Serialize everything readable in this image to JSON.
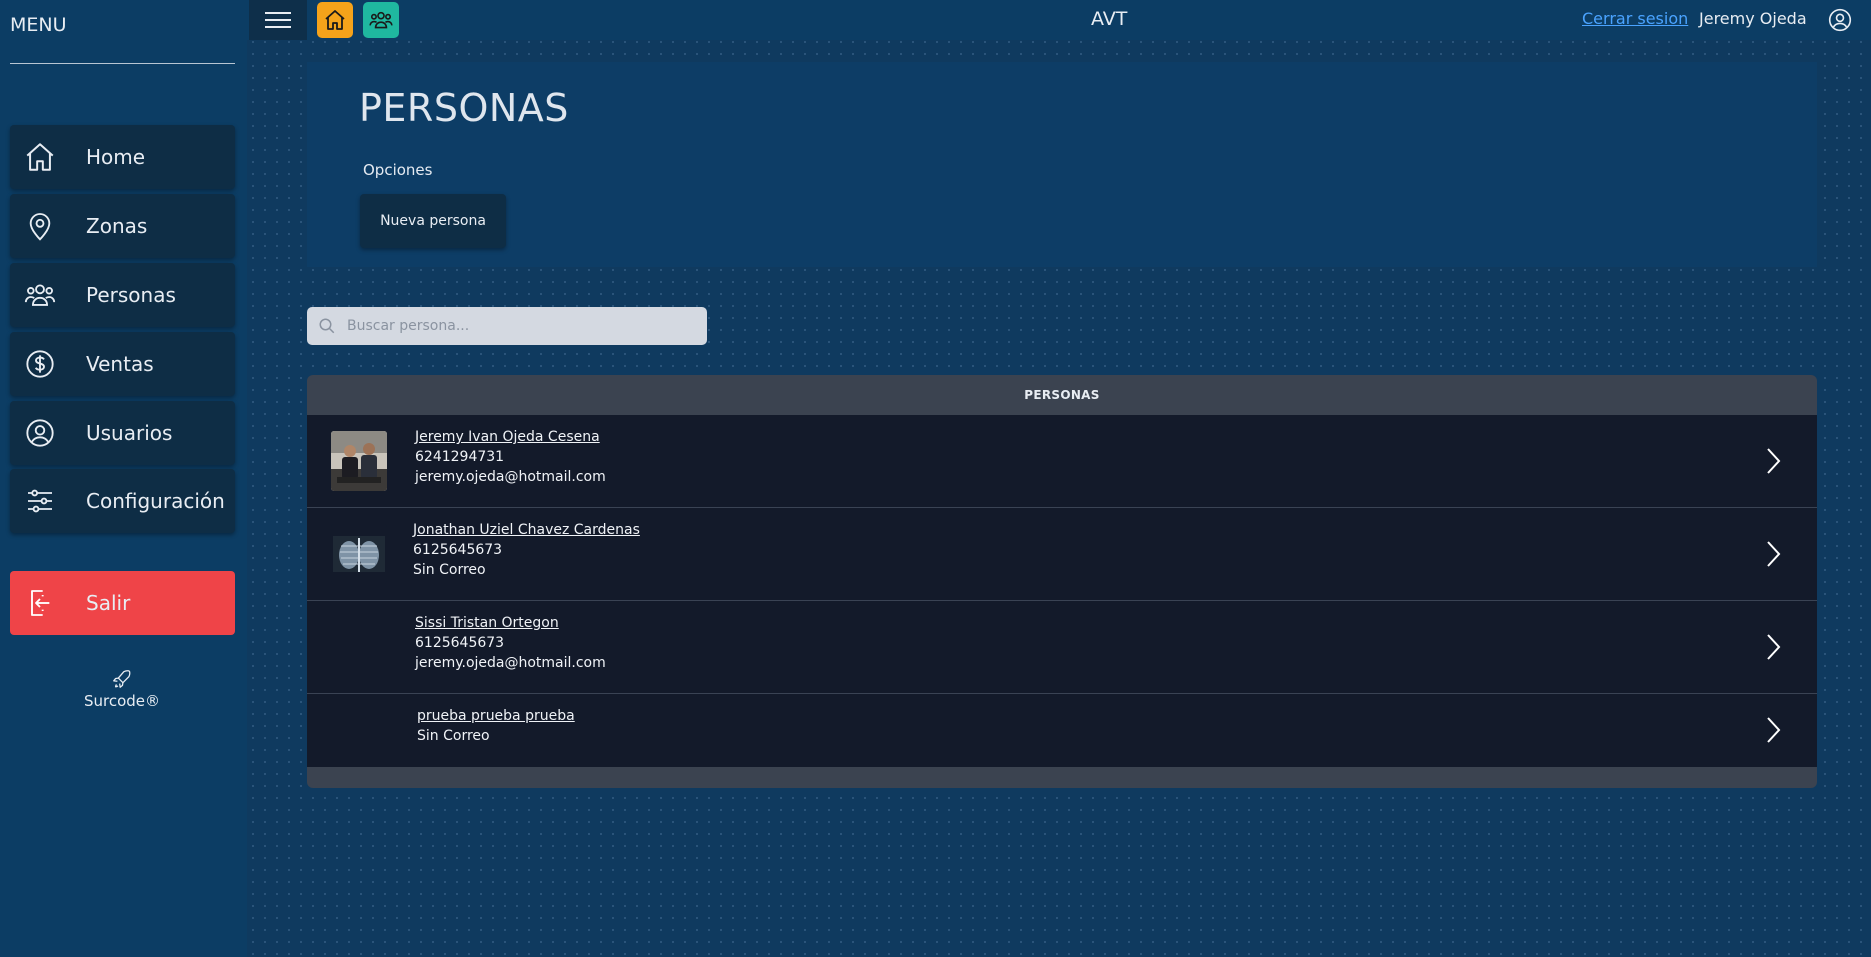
{
  "sidebar": {
    "menu_title": "MENU",
    "items": [
      {
        "label": "Home",
        "icon": "home-icon"
      },
      {
        "label": "Zonas",
        "icon": "map-pin-icon"
      },
      {
        "label": "Personas",
        "icon": "users-icon"
      },
      {
        "label": "Ventas",
        "icon": "dollar-icon"
      },
      {
        "label": "Usuarios",
        "icon": "user-circle-icon"
      },
      {
        "label": "Configuración",
        "icon": "sliders-icon"
      }
    ],
    "exit_label": "Salir",
    "brand": "Surcode®"
  },
  "topbar": {
    "app_title": "AVT",
    "logout_label": "Cerrar sesion",
    "user_name": "Jeremy Ojeda",
    "home_button_color": "#f5a31a",
    "people_button_color": "#1fb8a0"
  },
  "panel": {
    "title": "PERSONAS",
    "options_label": "Opciones",
    "new_button": "Nueva persona"
  },
  "search": {
    "placeholder": "Buscar persona..."
  },
  "table": {
    "header": "PERSONAS",
    "rows": [
      {
        "name": "Jeremy Ivan Ojeda Cesena",
        "phone": "6241294731",
        "email": "jeremy.ojeda@hotmail.com",
        "avatar": "photo"
      },
      {
        "name": "Jonathan Uziel Chavez Cardenas",
        "phone": "6125645673",
        "email": "Sin Correo",
        "avatar": "xray"
      },
      {
        "name": "Sissi Tristan Ortegon",
        "phone": "6125645673",
        "email": "jeremy.ojeda@hotmail.com",
        "avatar": "none"
      },
      {
        "name": "prueba prueba prueba",
        "phone": "",
        "email": "Sin Correo",
        "avatar": "none"
      }
    ]
  },
  "colors": {
    "sidebar_bg": "#0c3d64",
    "nav_item_bg": "#0e2d45",
    "exit_bg": "#ef4448",
    "row_bg": "#131a2a",
    "link": "#4aa3ff"
  }
}
